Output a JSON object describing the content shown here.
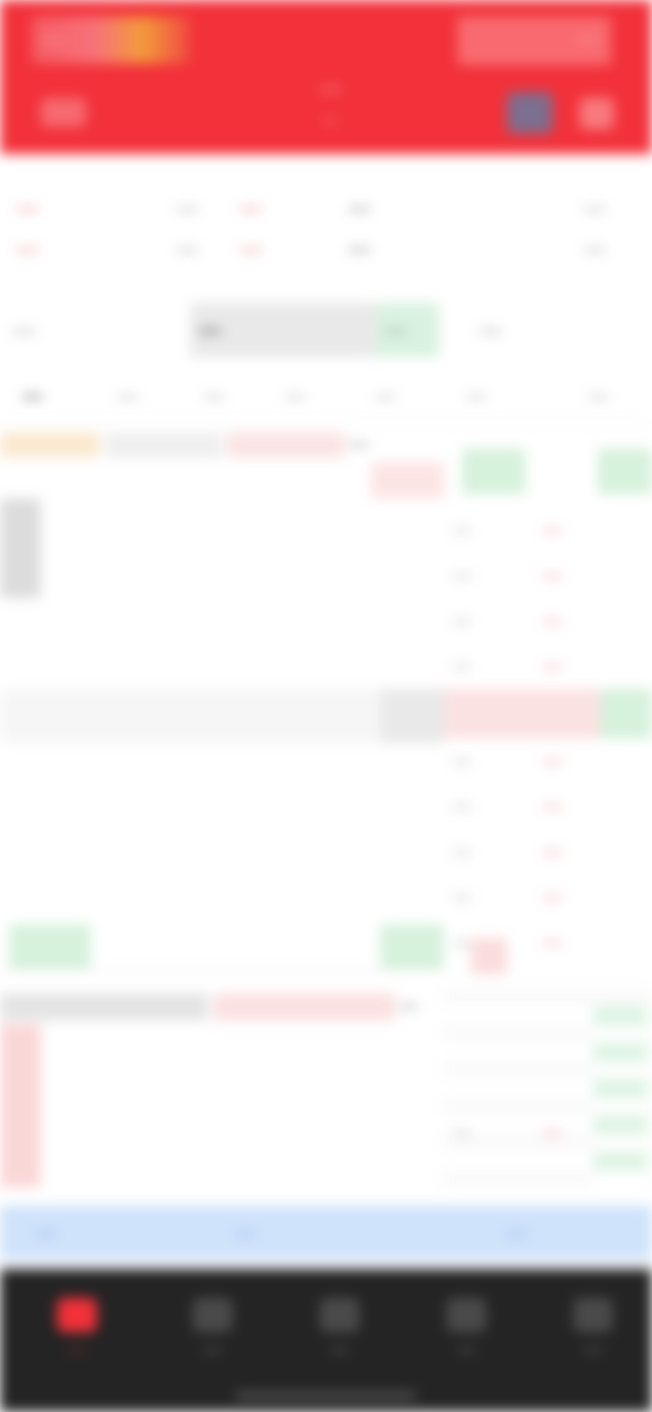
{
  "header": {
    "left_label": "—",
    "right_label": "—",
    "title": "—",
    "subtitle": "—"
  },
  "summary": {
    "price": "—",
    "change": "—",
    "change_pct": "—",
    "high_label": "—",
    "high": "—",
    "low_label": "—",
    "low": "—",
    "open_label": "—",
    "open": "—",
    "vol_label": "—",
    "vol": "—"
  },
  "tabs": [
    {
      "label": "—"
    },
    {
      "label": "—"
    },
    {
      "label": "—"
    },
    {
      "label": "—"
    }
  ],
  "subtabs": [
    {
      "label": "—"
    },
    {
      "label": "—"
    },
    {
      "label": "—"
    },
    {
      "label": "—"
    },
    {
      "label": "—"
    },
    {
      "label": "—"
    },
    {
      "label": "—"
    }
  ],
  "chart": {
    "ma_text": "—",
    "vol_text": "—"
  },
  "book": {
    "asks": [
      {
        "price": "—",
        "qty": "—"
      },
      {
        "price": "—",
        "qty": "—"
      },
      {
        "price": "—",
        "qty": "—"
      },
      {
        "price": "—",
        "qty": "—"
      },
      {
        "price": "—",
        "qty": "—"
      }
    ],
    "bids": [
      {
        "price": "—",
        "qty": "—"
      },
      {
        "price": "—",
        "qty": "—"
      },
      {
        "price": "—",
        "qty": "—"
      },
      {
        "price": "—",
        "qty": "—"
      },
      {
        "price": "—",
        "qty": "—"
      }
    ]
  },
  "trade_bar": {
    "left": "—",
    "center": "—",
    "right": "—"
  },
  "nav": [
    {
      "label": "—"
    },
    {
      "label": "—"
    },
    {
      "label": "—"
    },
    {
      "label": "—"
    },
    {
      "label": "—"
    }
  ],
  "colors": {
    "brand_red": "#f2313a",
    "up_red": "#e23a3a",
    "down_green": "#1fa24a",
    "nav_bg": "#242424",
    "trade_bar_bg": "#cfe3fb"
  }
}
